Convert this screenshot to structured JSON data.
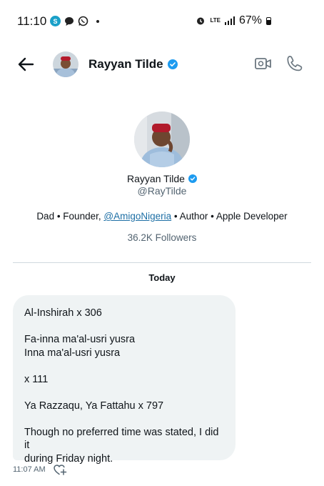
{
  "status_bar": {
    "time": "11:10",
    "lte": "LTE",
    "battery": "67%"
  },
  "header": {
    "name": "Rayyan Tilde"
  },
  "profile": {
    "name": "Rayyan Tilde",
    "handle": "@RayTilde",
    "bio_before": "Dad • Founder, ",
    "bio_link": "@AmigoNigeria",
    "bio_after": " • Author • Apple Developer",
    "followers": "36.2K Followers"
  },
  "conversation": {
    "date_label": "Today",
    "message": {
      "lines": [
        "Al-Inshirah x 306",
        "Fa-inna ma'al-usri yusra",
        "Inna ma'al-usri yusra",
        "x 111",
        "Ya Razzaqu, Ya Fattahu x 797",
        "Though no preferred time was stated, I did it",
        "during Friday night."
      ],
      "time": "11:07 AM"
    }
  },
  "colors": {
    "accent": "#1d9bf0",
    "bubble": "#eff3f4",
    "muted": "#536471"
  }
}
